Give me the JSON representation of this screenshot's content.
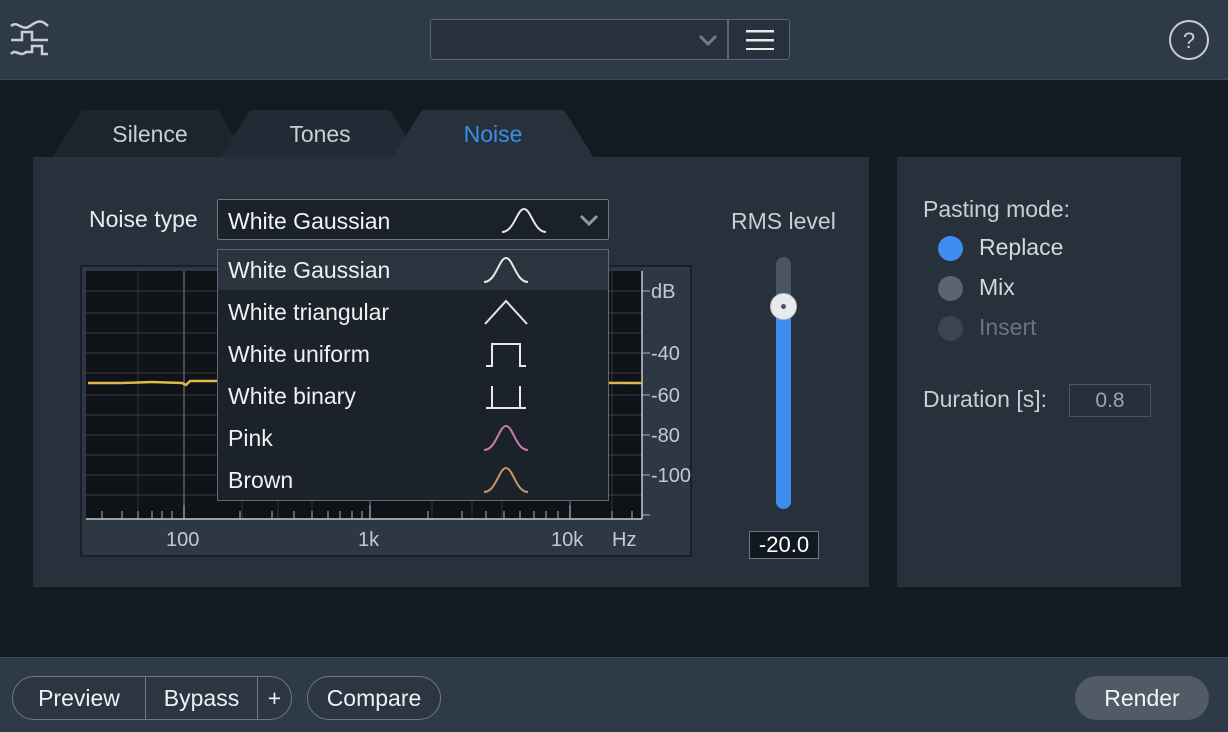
{
  "header": {
    "logo_icon": "rx-waveform-logo-icon",
    "preset_value": "",
    "preset_chevron_icon": "chevron-down-icon",
    "menu_icon": "hamburger-menu-icon",
    "help_label": "?"
  },
  "tabs": [
    {
      "label": "Silence",
      "active": false
    },
    {
      "label": "Tones",
      "active": false
    },
    {
      "label": "Noise",
      "active": true
    }
  ],
  "noise": {
    "label": "Noise type",
    "selected": "White Gaussian",
    "selected_shape_icon": "gaussian-curve-icon",
    "options": [
      {
        "label": "White Gaussian",
        "icon": "gaussian-curve-icon",
        "color": "#e8e8e8"
      },
      {
        "label": "White triangular",
        "icon": "triangle-wave-icon",
        "color": "#e8e8e8"
      },
      {
        "label": "White uniform",
        "icon": "uniform-pulse-icon",
        "color": "#e8e8e8"
      },
      {
        "label": "White binary",
        "icon": "binary-pulse-icon",
        "color": "#e8e8e8"
      },
      {
        "label": "Pink",
        "icon": "pink-curve-icon",
        "color": "#c77ab4"
      },
      {
        "label": "Brown",
        "icon": "brown-curve-icon",
        "color": "#c69566"
      }
    ]
  },
  "spectrum": {
    "x_ticks": [
      "100",
      "1k",
      "10k",
      "Hz"
    ],
    "y_ticks": [
      "dB",
      "-40",
      "-60",
      "-80",
      "-100"
    ],
    "trace_color": "#e0b84a"
  },
  "rms": {
    "label": "RMS level",
    "value": "-20.0",
    "level_fraction": 0.8,
    "accent": "#3d8ef0"
  },
  "pasting": {
    "title": "Pasting mode:",
    "options": [
      {
        "label": "Replace",
        "state": "selected"
      },
      {
        "label": "Mix",
        "state": "normal"
      },
      {
        "label": "Insert",
        "state": "disabled"
      }
    ],
    "duration_label": "Duration [s]:",
    "duration_value": "0.8"
  },
  "footer": {
    "preview": "Preview",
    "bypass": "Bypass",
    "plus": "+",
    "compare": "Compare",
    "render": "Render"
  }
}
